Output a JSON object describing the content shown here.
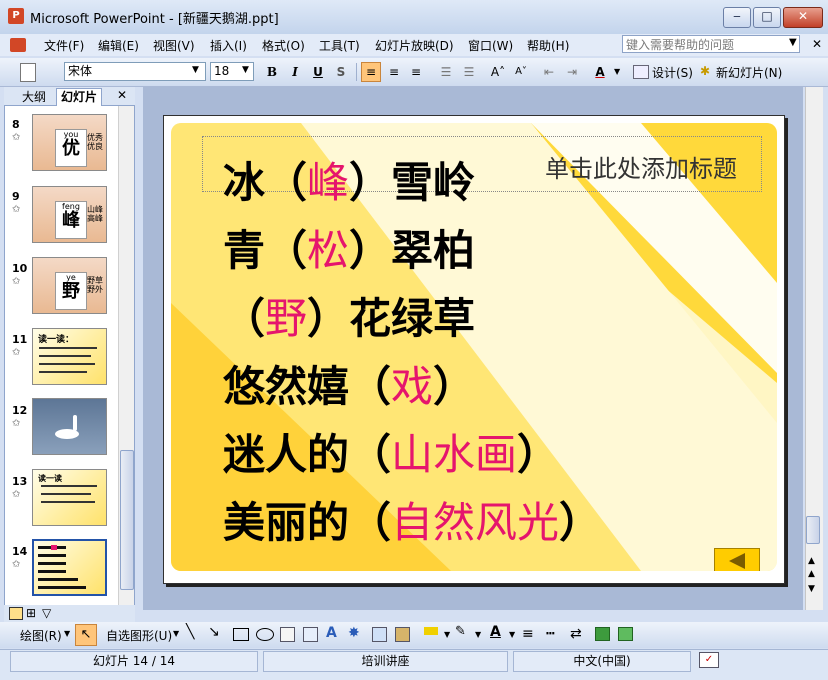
{
  "window": {
    "app_name": "Microsoft PowerPoint",
    "title": "Microsoft PowerPoint - [新疆天鹅湖.ppt]"
  },
  "menu": [
    "文件(F)",
    "编辑(E)",
    "视图(V)",
    "插入(I)",
    "格式(O)",
    "工具(T)",
    "幻灯片放映(D)",
    "窗口(W)",
    "帮助(H)"
  ],
  "help_search": {
    "placeholder": "键入需要帮助的问题"
  },
  "toolbar": {
    "font_name": "宋体",
    "font_size": "18",
    "bold": "B",
    "italic": "I",
    "underline": "U",
    "shadow": "S",
    "design_label": "设计(S)",
    "new_slide_label": "新幻灯片(N)"
  },
  "panel": {
    "tabs": [
      "大纲",
      "幻灯片"
    ],
    "active_tab": "幻灯片",
    "slides": [
      {
        "num": "8",
        "big": "优",
        "pinyin": "you",
        "side": "优秀 优良"
      },
      {
        "num": "9",
        "big": "峰",
        "pinyin": "feng",
        "side": "山峰 高峰"
      },
      {
        "num": "10",
        "big": "野",
        "pinyin": "ye",
        "side": "野草 野外"
      },
      {
        "num": "11",
        "big": "",
        "pinyin": "",
        "side": "读一读："
      },
      {
        "num": "12",
        "big": "",
        "pinyin": "",
        "side": ""
      },
      {
        "num": "13",
        "big": "",
        "pinyin": "",
        "side": "读一读"
      },
      {
        "num": "14",
        "big": "",
        "pinyin": "",
        "side": ""
      }
    ]
  },
  "slide": {
    "placeholder": "单击此处添加标题",
    "lines": [
      {
        "pre": "冰（",
        "ans": "峰",
        "post": "）雪岭"
      },
      {
        "pre": "青（",
        "ans": "松",
        "post": "）翠柏"
      },
      {
        "pre": "（",
        "ans": "野",
        "post": "）花绿草"
      },
      {
        "pre": "悠然嬉（",
        "ans": "戏",
        "post": "）"
      },
      {
        "pre": "迷人的（",
        "ans": "山水画",
        "post": "）"
      },
      {
        "pre": "美丽的（",
        "ans": "自然风光",
        "post": "）"
      }
    ],
    "answer_color": "#e5156d"
  },
  "drawbar": {
    "draw_label": "绘图(R)",
    "autoshape_label": "自选图形(U)"
  },
  "status": {
    "slide_pos": "幻灯片 14 / 14",
    "design": "培训讲座",
    "language": "中文(中国)"
  }
}
